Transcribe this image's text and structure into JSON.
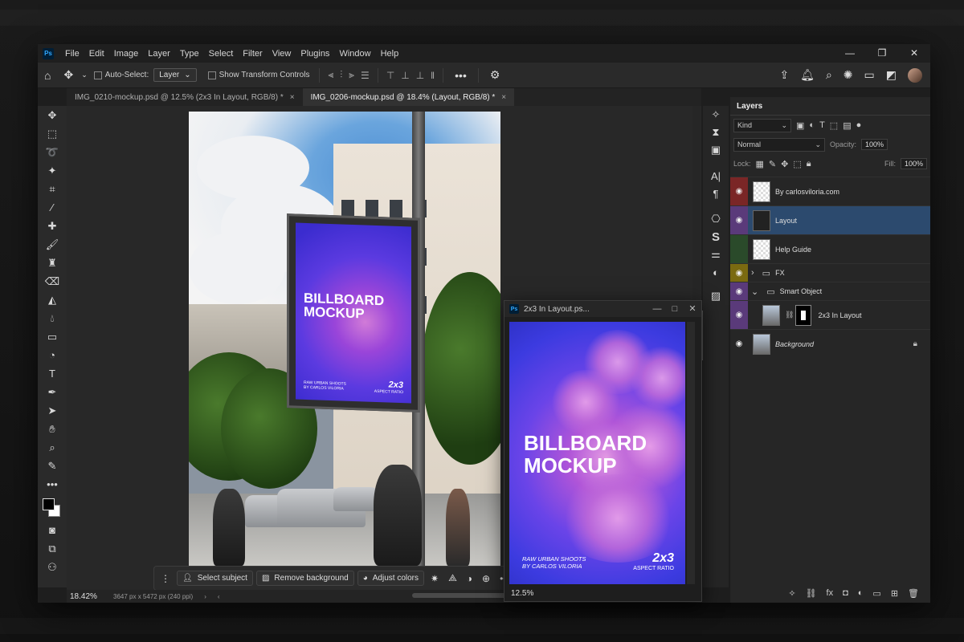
{
  "app": {
    "logo": "Ps"
  },
  "menu": [
    "File",
    "Edit",
    "Image",
    "Layer",
    "Type",
    "Select",
    "Filter",
    "View",
    "Plugins",
    "Window",
    "Help"
  ],
  "window_controls": {
    "minimize": "—",
    "restore": "❐",
    "close": "✕"
  },
  "options_bar": {
    "home_icon": "home-icon",
    "auto_select_label": "Auto-Select:",
    "auto_select_value": "Layer",
    "transform_label": "Show Transform Controls",
    "more_label": "•••"
  },
  "tabs": [
    {
      "label": "IMG_0210-mockup.psd @ 12.5% (2x3 In Layout, RGB/8) *",
      "active": false
    },
    {
      "label": "IMG_0206-mockup.psd @ 18.4% (Layout, RGB/8) *",
      "active": true
    }
  ],
  "billboard": {
    "title_line1": "BILLBOARD",
    "title_line2": "MOCKUP",
    "byline1": "RAW URBAN SHOOTS",
    "byline2": "BY CARLOS VILORIA",
    "ratio": "2x3",
    "ratio_label": "ASPECT RATIO"
  },
  "contextual_bar": {
    "select_subject": "Select subject",
    "remove_background": "Remove background",
    "adjust_colors": "Adjust colors",
    "more": "•••"
  },
  "status": {
    "zoom": "18.42%",
    "info": "3647 px x 5472 px (240 ppi)",
    "arrow": "›",
    "left_arrow": "‹"
  },
  "float_window": {
    "title": "2x3 In Layout.ps...",
    "zoom": "12.5%"
  },
  "layers_panel": {
    "title": "Layers",
    "kind_label": "Kind",
    "blend_mode": "Normal",
    "opacity_label": "Opacity:",
    "opacity_value": "100%",
    "lock_label": "Lock:",
    "fill_label": "Fill:",
    "fill_value": "100%",
    "layers": [
      {
        "name": "By carlosviloria.com",
        "color": "#7a2626"
      },
      {
        "name": "Layout",
        "color": "#5a3a7a"
      },
      {
        "name": "Help Guide",
        "color": "#2a4a2a"
      },
      {
        "name": "FX",
        "color": "#7a6a10"
      },
      {
        "name": "Smart Object",
        "color": "#5a3a7a"
      },
      {
        "name": "2x3 In Layout",
        "color": "#5a3a7a"
      },
      {
        "name": "Background",
        "color": "#262626"
      }
    ]
  },
  "colors": {
    "accent_selection": "#2c4a6e",
    "ps_blue": "#31a8ff"
  }
}
